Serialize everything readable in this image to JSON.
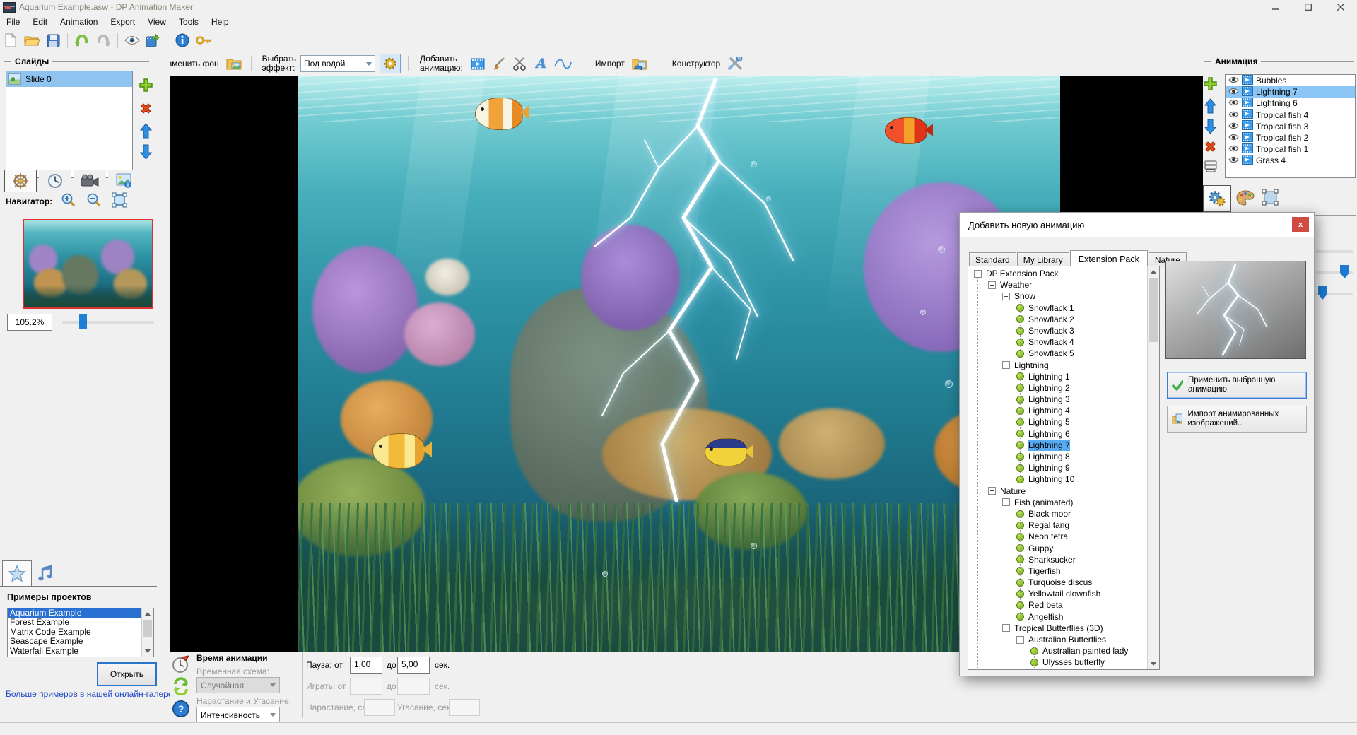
{
  "window": {
    "title": "Aquarium Example.asw - DP Animation Maker",
    "controls": [
      "minimize",
      "maximize",
      "close"
    ]
  },
  "menu": [
    "File",
    "Edit",
    "Animation",
    "Export",
    "View",
    "Tools",
    "Help"
  ],
  "effects_bar": {
    "change_background": "Изменить фон",
    "select_effect_label": "Выбрать\nэффект:",
    "effect_value": "Под водой",
    "add_animation_label": "Добавить\nанимацию:",
    "import_label": "Импорт",
    "constructor_label": "Конструктор"
  },
  "slides_panel": {
    "title": "Слайды",
    "slides": [
      "Slide 0"
    ],
    "selected_index": 0
  },
  "navigator": {
    "label": "Навигатор:",
    "zoom_value": "105.2%"
  },
  "examples_panel": {
    "title": "Примеры проектов",
    "items": [
      "Aquarium Example",
      "Forest Example",
      "Matrix Code Example",
      "Seascape Example",
      "Waterfall Example"
    ],
    "selected_index": 0,
    "open_button": "Открыть",
    "gallery_link": "Больше примеров в нашей онлайн-галерее"
  },
  "animation_panel": {
    "title": "Анимация",
    "items": [
      "Bubbles",
      "Lightning 7",
      "Lightning 6",
      "Tropical fish 4",
      "Tropical fish 3",
      "Tropical fish 2",
      "Tropical fish 1",
      "Grass 4"
    ],
    "selected_index": 1
  },
  "add_dialog": {
    "title": "Добавить новую анимацию",
    "tabs": [
      "Standard",
      "My Library",
      "Extension Pack",
      "Nature"
    ],
    "selected_tab_index": 2,
    "apply_button": "Применить выбранную анимацию",
    "import_button": "Импорт анимированных изображений..",
    "tree": [
      {
        "label": "DP Extension Pack",
        "level": 0,
        "kind": "node"
      },
      {
        "label": "Weather",
        "level": 1,
        "kind": "node"
      },
      {
        "label": "Snow",
        "level": 2,
        "kind": "node"
      },
      {
        "label": "Snowflack 1",
        "level": 3,
        "kind": "leaf"
      },
      {
        "label": "Snowflack 2",
        "level": 3,
        "kind": "leaf"
      },
      {
        "label": "Snowflack 3",
        "level": 3,
        "kind": "leaf"
      },
      {
        "label": "Snowflack 4",
        "level": 3,
        "kind": "leaf"
      },
      {
        "label": "Snowflack 5",
        "level": 3,
        "kind": "leaf"
      },
      {
        "label": "Lightning",
        "level": 2,
        "kind": "node"
      },
      {
        "label": "Lightning 1",
        "level": 3,
        "kind": "leaf"
      },
      {
        "label": "Lightning 2",
        "level": 3,
        "kind": "leaf"
      },
      {
        "label": "Lightning 3",
        "level": 3,
        "kind": "leaf"
      },
      {
        "label": "Lightning 4",
        "level": 3,
        "kind": "leaf"
      },
      {
        "label": "Lightning 5",
        "level": 3,
        "kind": "leaf"
      },
      {
        "label": "Lightning 6",
        "level": 3,
        "kind": "leaf"
      },
      {
        "label": "Lightning 7",
        "level": 3,
        "kind": "leaf",
        "selected": true
      },
      {
        "label": "Lightning 8",
        "level": 3,
        "kind": "leaf"
      },
      {
        "label": "Lightning 9",
        "level": 3,
        "kind": "leaf"
      },
      {
        "label": "Lightning 10",
        "level": 3,
        "kind": "leaf"
      },
      {
        "label": "Nature",
        "level": 1,
        "kind": "node"
      },
      {
        "label": "Fish (animated)",
        "level": 2,
        "kind": "node"
      },
      {
        "label": "Black moor",
        "level": 3,
        "kind": "leaf"
      },
      {
        "label": "Regal tang",
        "level": 3,
        "kind": "leaf"
      },
      {
        "label": "Neon tetra",
        "level": 3,
        "kind": "leaf"
      },
      {
        "label": "Guppy",
        "level": 3,
        "kind": "leaf"
      },
      {
        "label": "Sharksucker",
        "level": 3,
        "kind": "leaf"
      },
      {
        "label": "Tigerfish",
        "level": 3,
        "kind": "leaf"
      },
      {
        "label": "Turquoise discus",
        "level": 3,
        "kind": "leaf"
      },
      {
        "label": "Yellowtail clownfish",
        "level": 3,
        "kind": "leaf"
      },
      {
        "label": "Red beta",
        "level": 3,
        "kind": "leaf"
      },
      {
        "label": "Angelfish",
        "level": 3,
        "kind": "leaf"
      },
      {
        "label": "Tropical Butterflies (3D)",
        "level": 2,
        "kind": "node"
      },
      {
        "label": "Australian Butterflies",
        "level": 3,
        "kind": "node"
      },
      {
        "label": "Australian painted lady",
        "level": 4,
        "kind": "leaf"
      },
      {
        "label": "Ulysses butterfly",
        "level": 4,
        "kind": "leaf"
      },
      {
        "label": "",
        "level": 4,
        "kind": "leaf"
      }
    ]
  },
  "timing_panel": {
    "title": "Время анимации",
    "scheme_label": "Временная схема:",
    "scheme_value": "Случайная",
    "fade_label": "Нарастание и Угасание:",
    "fade_value": "Интенсивность",
    "pause_label": "Пауза: от",
    "pause_from": "1,00",
    "to_label": "до",
    "pause_to": "5,00",
    "sec_label": "сек.",
    "play_label": "Играть: от",
    "rise_label": "Нарастание, сек:",
    "fall_label": "Угасание, сек:"
  },
  "icons": [
    "new-file-icon",
    "open-folder-icon",
    "save-icon",
    "undo-icon",
    "redo-icon",
    "preview-eye-icon",
    "export-video-icon",
    "info-icon",
    "license-key-icon",
    "change-background-icon",
    "effect-gear-icon",
    "add-video-icon",
    "brush-icon",
    "scissors-icon",
    "text-icon",
    "wave-icon",
    "import-folder-icon",
    "constructor-tools-icon",
    "ship-wheel-icon",
    "clock-icon",
    "video-camera-icon",
    "image-info-icon",
    "zoom-in-icon",
    "zoom-out-icon",
    "zoom-fit-icon",
    "star-icon",
    "music-note-icon",
    "add-icon",
    "delete-icon",
    "move-up-icon",
    "move-down-icon",
    "layers-icon",
    "visibility-eye-icon",
    "gear-tab-icon",
    "palette-icon",
    "transform-icon",
    "alarm-clock-icon",
    "loop-icon",
    "help-icon",
    "apply-check-icon",
    "import-images-icon",
    "close-icon"
  ],
  "colors": {
    "selection_strong_blue": "#2a6fd2",
    "selection_light_blue": "#8cc6f7",
    "tree_selection": "#57aaf2",
    "accent_green": "#6abe30",
    "danger_red": "#d14a43",
    "link_blue": "#2047c8"
  }
}
